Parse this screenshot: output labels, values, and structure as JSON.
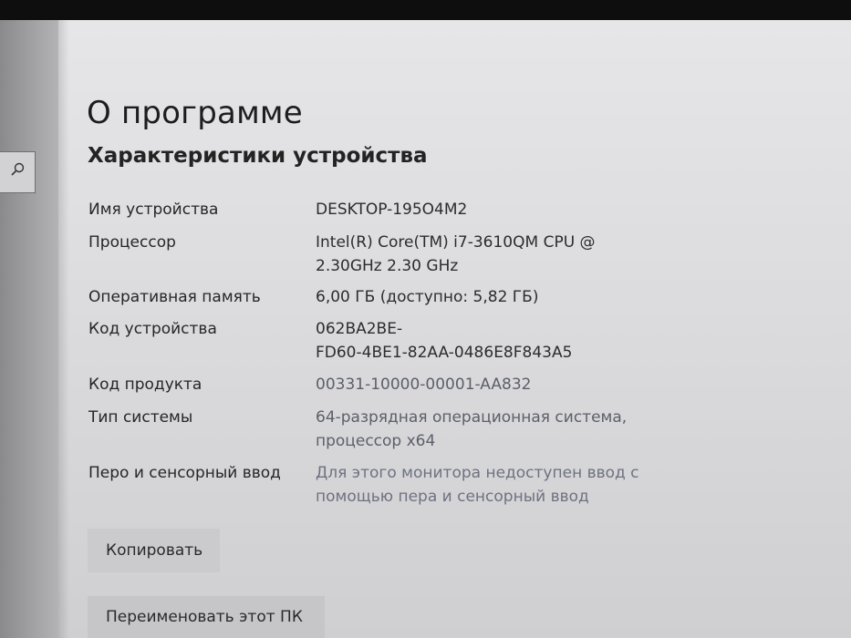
{
  "window": {
    "page_title": "О программе",
    "section_title": "Характеристики устройства"
  },
  "sidebar": {
    "search_icon": "search-icon"
  },
  "specs": {
    "device_name": {
      "label": "Имя устройства",
      "value": "DESKTOP-195O4M2"
    },
    "processor": {
      "label": "Процессор",
      "line1": "Intel(R) Core(TM) i7-3610QM CPU @",
      "line2": "2.30GHz   2.30 GHz"
    },
    "ram": {
      "label": "Оперативная память",
      "value": "6,00 ГБ (доступно: 5,82 ГБ)"
    },
    "device_id": {
      "label": "Код устройства",
      "line1": "062BA2BE-",
      "line2": "FD60-4BE1-82AA-0486E8F843A5"
    },
    "product_id": {
      "label": "Код продукта",
      "value": "00331-10000-00001-AA832"
    },
    "system_type": {
      "label": "Тип системы",
      "line1": "64-разрядная операционная система,",
      "line2": "процессор x64"
    },
    "pen_touch": {
      "label": "Перо и сенсорный ввод",
      "line1": "Для этого монитора недоступен ввод с",
      "line2": "помощью пера и сенсорный ввод"
    }
  },
  "buttons": {
    "copy_label": "Копировать",
    "rename_label": "Переименовать этот ПК"
  }
}
